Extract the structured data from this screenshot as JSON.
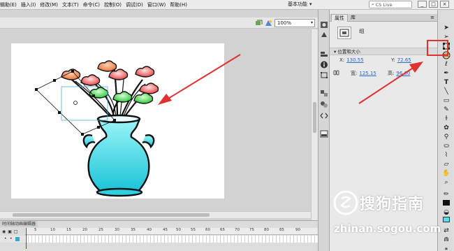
{
  "menubar": {
    "items": [
      "辑助(E)",
      "插入(I)",
      "修改(M)",
      "文本(T)",
      "命令(C)",
      "控制(O)",
      "调试(D)",
      "窗口(W)",
      "帮助(H)"
    ],
    "workspace": "基本功能",
    "search_label": "CS Live",
    "window_buttons": [
      "_",
      "□",
      "×"
    ]
  },
  "stage": {
    "zoom": "100%",
    "vertical_scroll_position": 0.4,
    "horizontal_scroll_position": 0.05
  },
  "timeline": {
    "tab": "时间轴动画编辑器",
    "frame_numbers": [
      "5",
      "10",
      "15",
      "20",
      "25",
      "30",
      "35",
      "40",
      "45",
      "50",
      "55",
      "60",
      "65",
      "70",
      "75",
      "80",
      "85",
      "90"
    ]
  },
  "panel": {
    "tabs": [
      "属性",
      "库"
    ],
    "instance_type": "组",
    "section_title": "位置和大小",
    "x_label": "X:",
    "x_value": "130.55",
    "y_label": "Y:",
    "y_value": "72.65",
    "w_label": "宽:",
    "w_value": "125.15",
    "h_label": "高:",
    "h_value": "96.60"
  },
  "tools": {
    "icons": [
      "selection-tool",
      "subselection-tool",
      "free-transform-tool",
      "3d-rotation-tool",
      "lasso-tool",
      "pen-tool",
      "text-tool",
      "line-tool",
      "rectangle-tool",
      "pencil-tool",
      "brush-tool",
      "deco-tool",
      "bone-tool",
      "paint-bucket-tool",
      "eyedropper-tool",
      "eraser-tool",
      "hand-tool",
      "zoom-tool",
      "stroke-color",
      "fill-color"
    ]
  },
  "colors": {
    "red_annotation": "#e03030",
    "fill_swatch": "#4ee3ef",
    "vase_fill_top": "#9ff6f8",
    "vase_fill_bottom": "#1bc4d9",
    "link_value": "#2a6bc6"
  },
  "watermark": {
    "brand": "搜狗指南",
    "url": "zhinan.sogou.com"
  }
}
